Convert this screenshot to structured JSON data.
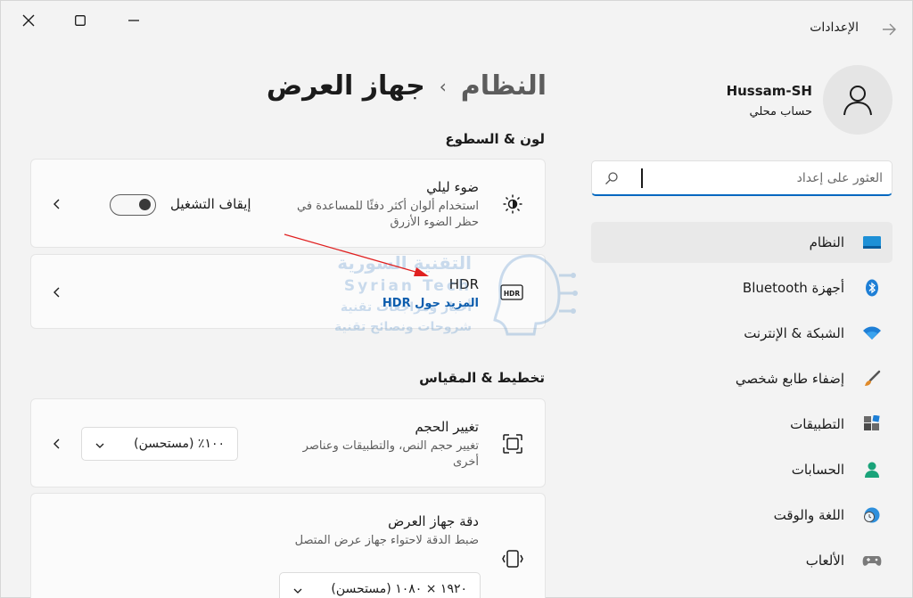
{
  "window": {
    "title": "الإعدادات",
    "controls": {
      "close": "close",
      "maximize": "maximize",
      "minimize": "minimize",
      "back": "back"
    }
  },
  "profile": {
    "name": "Hussam-SH",
    "account_type": "حساب محلي"
  },
  "search": {
    "placeholder": "العثور على إعداد"
  },
  "sidebar": {
    "items": [
      {
        "label": "النظام",
        "icon": "display-icon",
        "active": true
      },
      {
        "label": "أجهزة Bluetooth",
        "icon": "bluetooth-icon"
      },
      {
        "label": "الشبكة & الإنترنت",
        "icon": "wifi-icon"
      },
      {
        "label": "إضفاء طابع شخصي",
        "icon": "brush-icon"
      },
      {
        "label": "التطبيقات",
        "icon": "apps-icon"
      },
      {
        "label": "الحسابات",
        "icon": "person-icon"
      },
      {
        "label": "اللغة والوقت",
        "icon": "globe-clock-icon"
      },
      {
        "label": "الألعاب",
        "icon": "gamepad-icon"
      }
    ]
  },
  "breadcrumb": {
    "parent": "النظام",
    "separator": "›",
    "current": "جهاز العرض"
  },
  "sections": {
    "color_brightness": "لون & السطوع",
    "scale_layout": "تخطيط & المقياس"
  },
  "night_light": {
    "title": "ضوء ليلي",
    "description": "استخدام ألوان أكثر دفئًا للمساعدة في حظر الضوء الأزرق",
    "toggle_label": "إيقاف التشغيل",
    "toggle_on": false
  },
  "hdr": {
    "title": "HDR",
    "link": "المزيد حول HDR",
    "icon_text": "HDR"
  },
  "scale": {
    "title": "تغيير الحجم",
    "description": "تغيير حجم النص، والتطبيقات وعناصر أخرى",
    "value": "١٠٠٪ (مستحسن)"
  },
  "resolution": {
    "title": "دقة جهاز العرض",
    "description": "ضبط الدقة لاحتواء جهاز عرض المتصل",
    "value": "١٩٢٠ × ١٠٨٠ (مستحسن)"
  },
  "watermark": {
    "line1": "التقنية السورية",
    "line2": "Syrian Tech",
    "line3": "أخبار ومراجعات تقنية",
    "line4": "شروحات ونصائح تقنية"
  },
  "colors": {
    "accent": "#0067c0",
    "link": "#0b5cad",
    "annotation": "#e02020"
  }
}
